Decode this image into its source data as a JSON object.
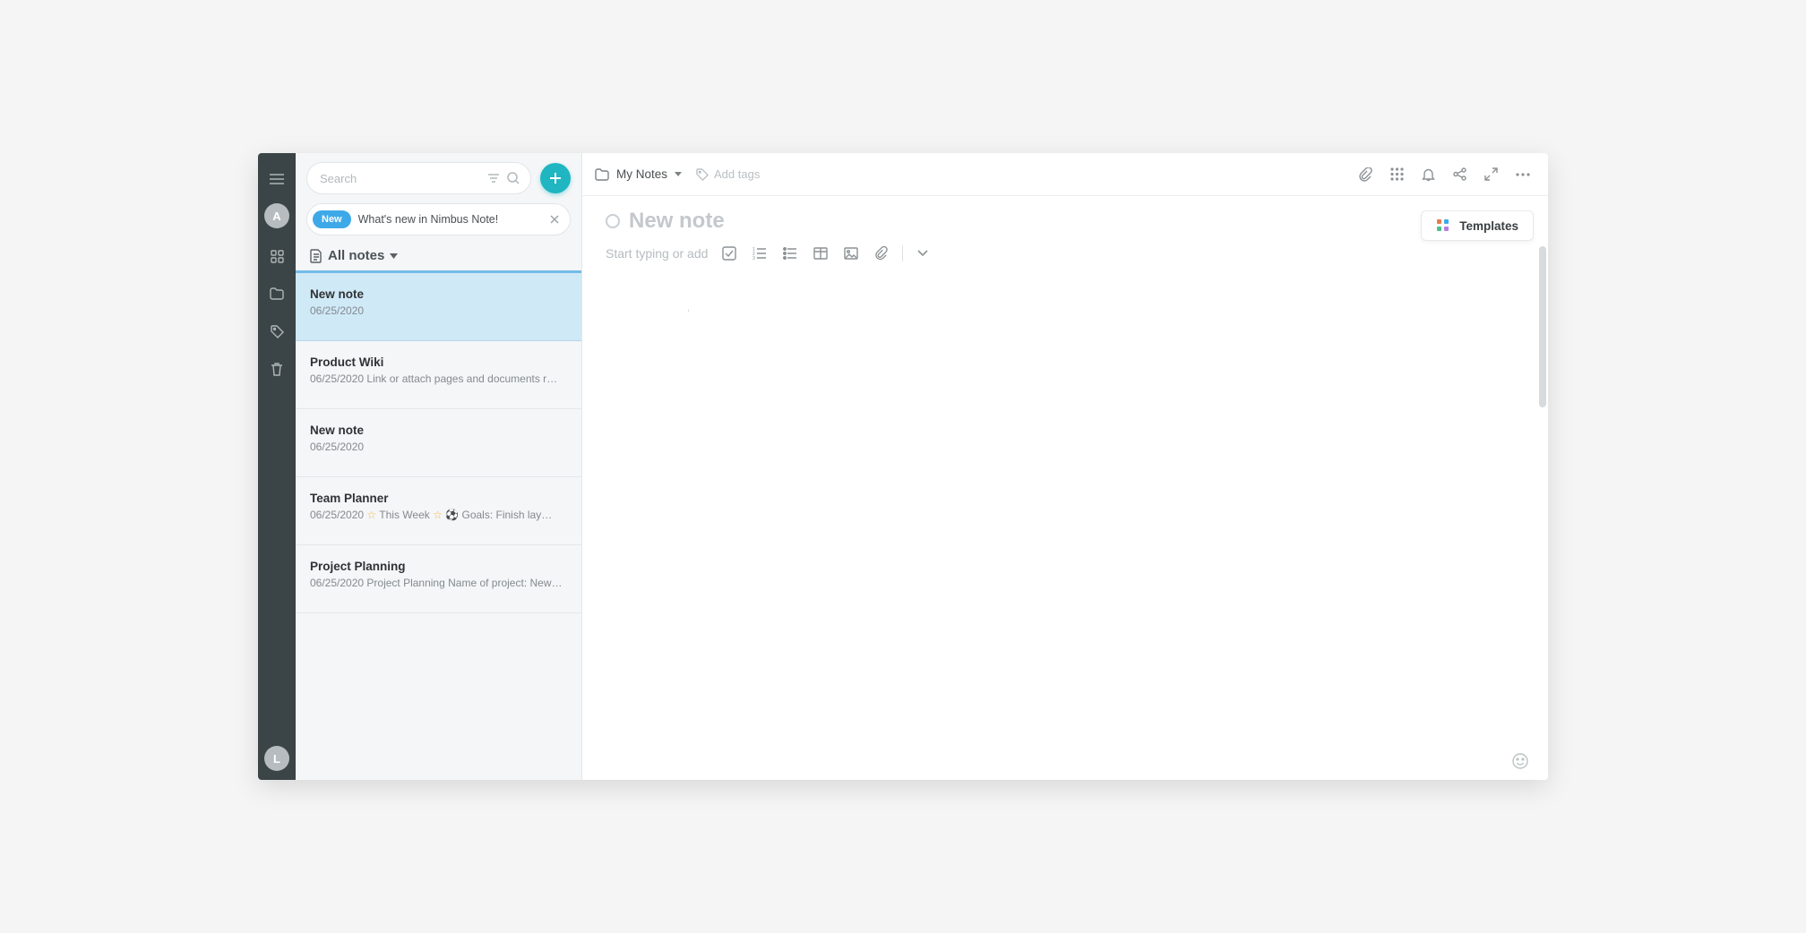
{
  "rail": {
    "avatar_letter_top": "A",
    "avatar_letter_bottom": "L"
  },
  "list": {
    "search_placeholder": "Search",
    "announce_pill": "New",
    "announce_text": "What's new in Nimbus Note!",
    "header_title": "All notes",
    "items": [
      {
        "title": "New note",
        "sub": "06/25/2020",
        "selected": true
      },
      {
        "title": "Product Wiki",
        "sub": "06/25/2020 Link or attach pages and documents r…",
        "selected": false
      },
      {
        "title": "New note",
        "sub": "06/25/2020",
        "selected": false
      },
      {
        "title": "Team Planner",
        "sub": "06/25/2020 ☆ This Week ☆ ⚽ Goals: Finish lay…",
        "selected": false,
        "special": true
      },
      {
        "title": "Project Planning",
        "sub": "06/25/2020 Project Planning Name of project: New…",
        "selected": false
      }
    ]
  },
  "editor": {
    "breadcrumb": "My Notes",
    "add_tags": "Add tags",
    "title_placeholder": "New note",
    "body_hint": "Start typing or add",
    "templates_label": "Templates"
  }
}
